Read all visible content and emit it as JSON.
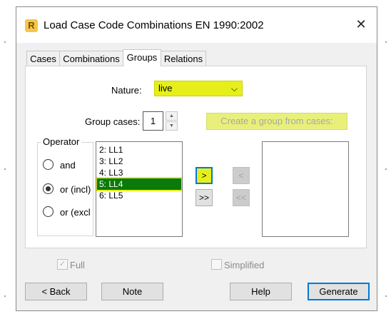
{
  "window": {
    "title": "Load Case Code Combinations EN 1990:2002",
    "app_icon_letter": "R",
    "close_glyph": "✕"
  },
  "tabs": [
    {
      "label": "Cases",
      "active": false
    },
    {
      "label": "Combinations",
      "active": false
    },
    {
      "label": "Groups",
      "active": true
    },
    {
      "label": "Relations",
      "active": false
    }
  ],
  "nature": {
    "label": "Nature:",
    "value": "live",
    "arrow_glyph": "⌵"
  },
  "group_cases": {
    "label": "Group cases:",
    "value": "1",
    "up_glyph": "▲",
    "down_glyph": "▼"
  },
  "create_group_button": {
    "label": "Create a group from cases:"
  },
  "operator": {
    "title": "Operator",
    "options": [
      {
        "label": "and",
        "checked": false
      },
      {
        "label": "or (incl)",
        "checked": true
      },
      {
        "label": "or (excl",
        "checked": false
      }
    ]
  },
  "cases_list": [
    {
      "label": "2: LL1",
      "selected": false
    },
    {
      "label": "3: LL2",
      "selected": false
    },
    {
      "label": "4: LL3",
      "selected": false
    },
    {
      "label": "5: LL4",
      "selected": true
    },
    {
      "label": "6: LL5",
      "selected": false
    }
  ],
  "transfer_buttons": {
    "add": ">",
    "add_all": ">>",
    "remove": "<",
    "remove_all": "<<"
  },
  "full": {
    "label": "Full",
    "checked": true,
    "check_glyph": "✓"
  },
  "simplified": {
    "label": "Simplified",
    "checked": false
  },
  "buttons": {
    "back": "< Back",
    "note": "Note",
    "help": "Help",
    "generate": "Generate"
  },
  "colors": {
    "highlight": "#e6ef1a",
    "selection": "#0a7a0a",
    "focus": "#0078d7"
  }
}
